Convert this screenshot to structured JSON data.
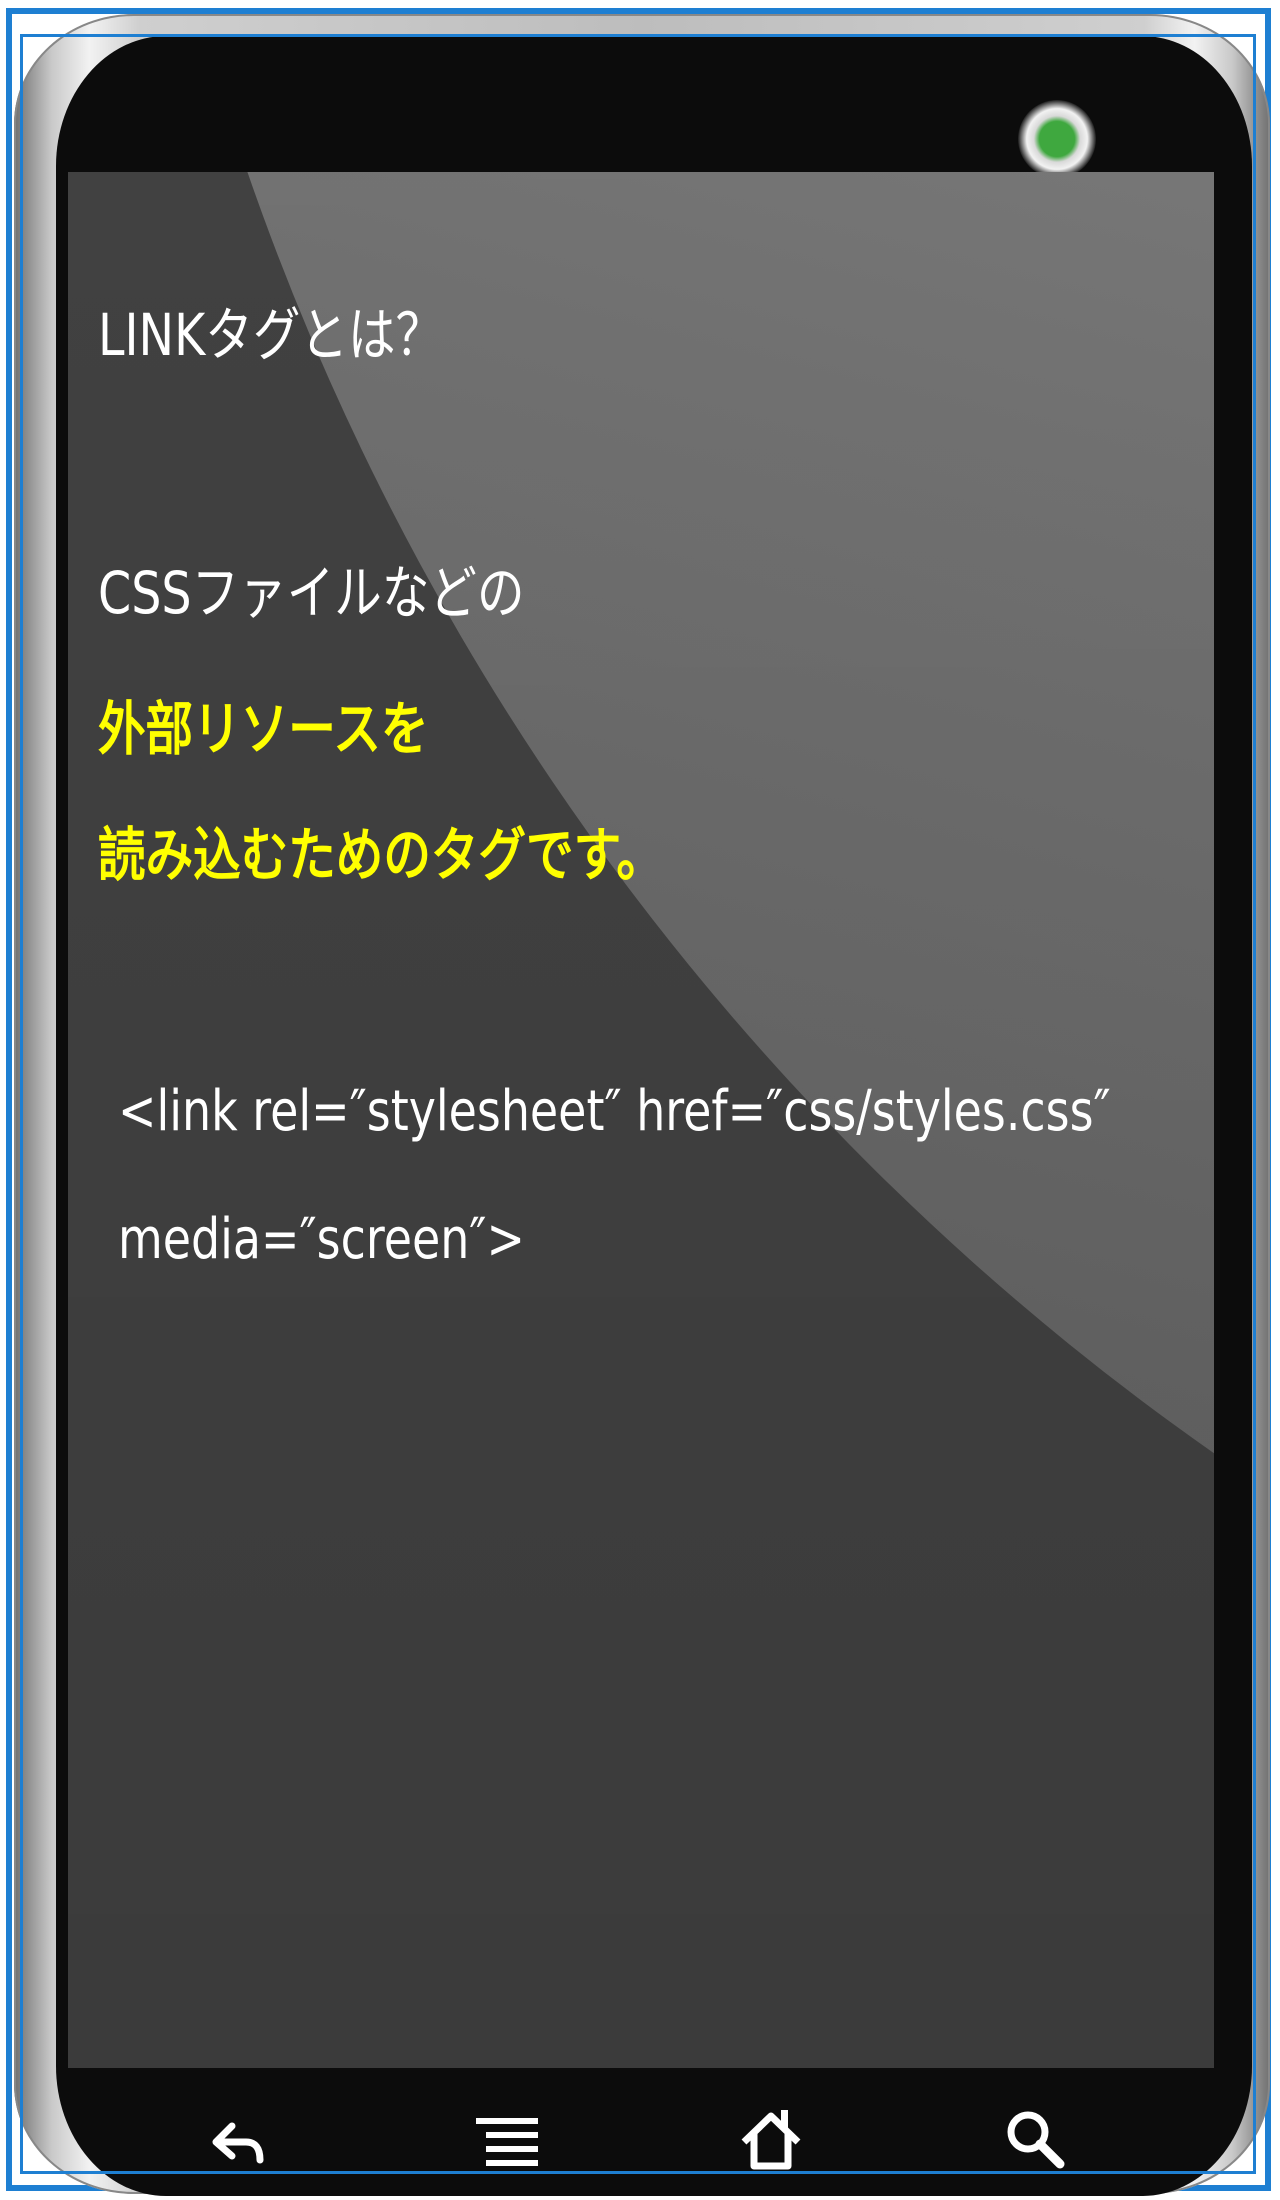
{
  "screen": {
    "title": "LINKタグとは？",
    "line1": "CSSファイルなどの",
    "line2": "外部リソースを",
    "line3": "読み込むためのタグです。",
    "code_line1": "<link rel=″stylesheet″ href=″css/styles.css″",
    "code_line2": "media=″screen″>"
  },
  "colors": {
    "text": "#ffffff",
    "highlight": "#ffff00",
    "frame_border": "#1e7fd2",
    "camera_led": "#3fa83f"
  },
  "navbar": {
    "icons": [
      "back-icon",
      "menu-icon",
      "home-icon",
      "search-icon"
    ]
  }
}
